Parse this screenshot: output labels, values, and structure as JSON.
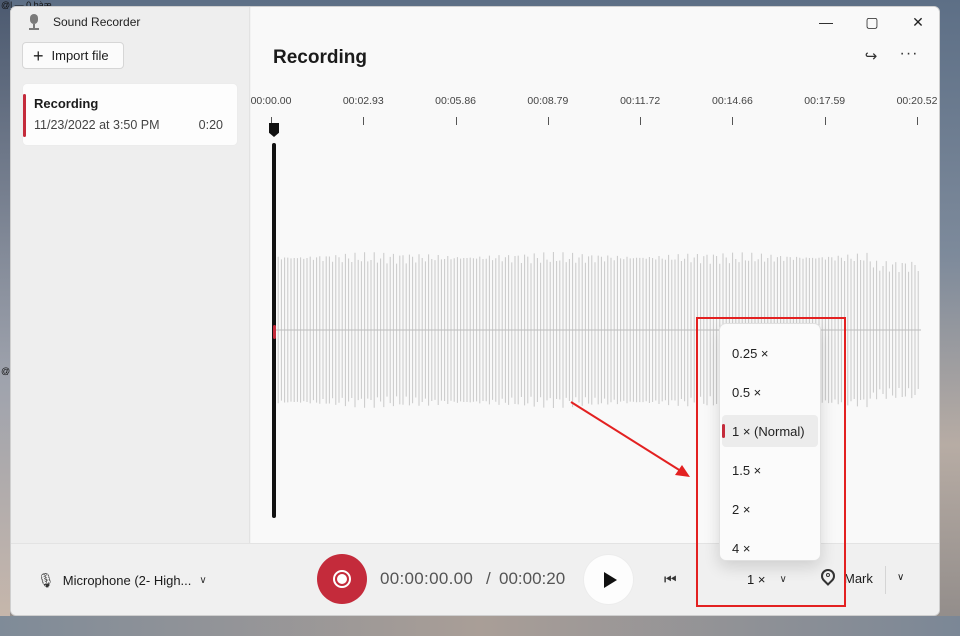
{
  "desktop": {
    "top_left_text": "@ḻ — 0 þàæ",
    "mid_left_glyph": "@"
  },
  "app": {
    "title": "Sound Recorder"
  },
  "window_controls": {
    "minimize": "—",
    "maximize": "▢",
    "close": "✕"
  },
  "sidebar": {
    "import_label": "Import file",
    "recordings": [
      {
        "name": "Recording",
        "date": "11/23/2022 at 3:50 PM",
        "duration": "0:20"
      }
    ]
  },
  "main": {
    "title": "Recording",
    "timeline_ticks": [
      "00:00.00",
      "00:02.93",
      "00:05.86",
      "00:08.79",
      "00:11.72",
      "00:14.66",
      "00:17.59",
      "00:20.52"
    ]
  },
  "bottom": {
    "microphone_label": "Microphone (2- High...",
    "current_time": "00:00:00.00",
    "separator": "/",
    "total_time": "00:00:20",
    "speed_label": "1 ×",
    "mark_label": "Mark"
  },
  "speed_menu": {
    "options": [
      "0.25 ×",
      "0.5 ×",
      "1 × (Normal)",
      "1.5 ×",
      "2 ×",
      "4 ×"
    ],
    "selected": "1 × (Normal)"
  },
  "colors": {
    "accent": "#c42b3b",
    "annotation": "#e32121",
    "wave": "#c9c9c9"
  },
  "icons": [
    "microphone-app-icon",
    "plus-icon",
    "share-icon",
    "more-icon",
    "mic-icon",
    "chevron-down-icon",
    "record-icon",
    "play-icon",
    "skip-back-icon",
    "pin-icon"
  ]
}
